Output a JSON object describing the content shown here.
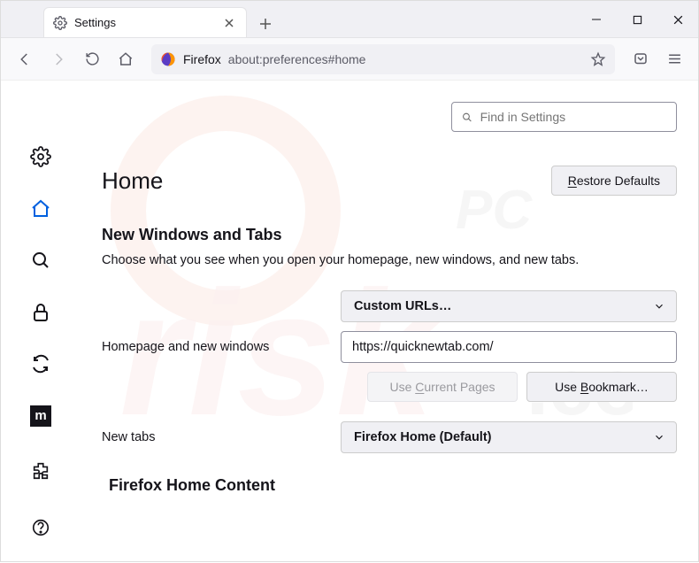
{
  "tab": {
    "title": "Settings"
  },
  "urlbar": {
    "identity": "Firefox",
    "url": "about:preferences#home"
  },
  "search": {
    "placeholder": "Find in Settings"
  },
  "page": {
    "title": "Home",
    "restore": "Restore Defaults",
    "section1_title": "New Windows and Tabs",
    "section1_desc": "Choose what you see when you open your homepage, new windows, and new tabs.",
    "homepage_label": "Homepage and new windows",
    "homepage_select": "Custom URLs…",
    "homepage_url": "https://quicknewtab.com/",
    "use_current": "Use Current Pages",
    "use_bookmark": "Use Bookmark…",
    "newtabs_label": "New tabs",
    "newtabs_select": "Firefox Home (Default)",
    "section2_title": "Firefox Home Content"
  }
}
